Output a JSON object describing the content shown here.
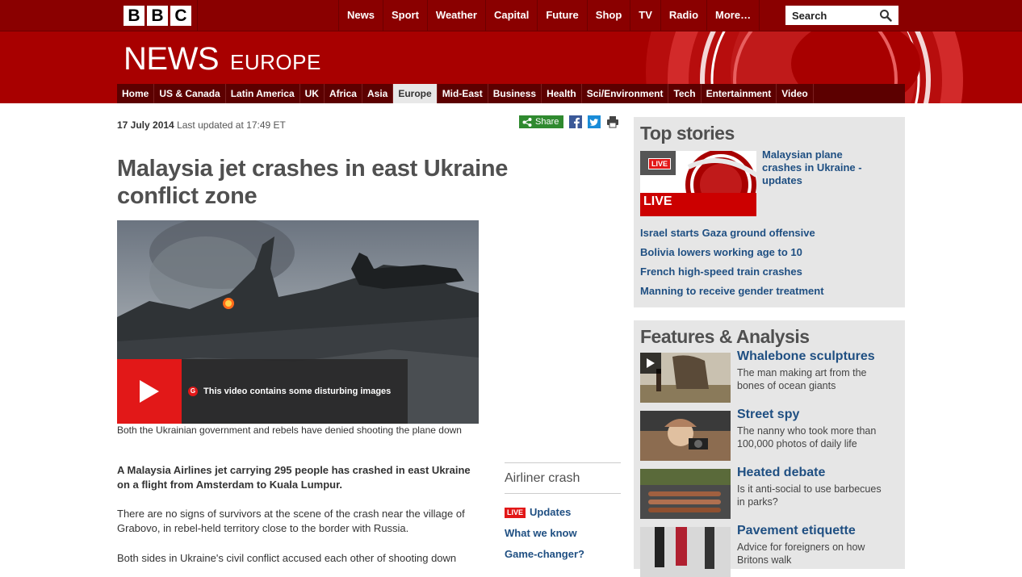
{
  "topbar": {
    "logo_letters": [
      "B",
      "B",
      "C"
    ],
    "nav": [
      "News",
      "Sport",
      "Weather",
      "Capital",
      "Future",
      "Shop",
      "TV",
      "Radio",
      "More…"
    ],
    "search_placeholder": "Search"
  },
  "masthead": {
    "news": "NEWS",
    "region": "EUROPE"
  },
  "section_nav": [
    "Home",
    "US & Canada",
    "Latin America",
    "UK",
    "Africa",
    "Asia",
    "Europe",
    "Mid-East",
    "Business",
    "Health",
    "Sci/Environment",
    "Tech",
    "Entertainment",
    "Video"
  ],
  "section_nav_active": "Europe",
  "article": {
    "date": "17 July 2014",
    "updated": "Last updated at 17:49 ET",
    "share_label": "Share",
    "headline": "Malaysia jet crashes in east Ukraine conflict zone",
    "video_badge": "G",
    "video_warning": "This video contains some disturbing images",
    "caption": "Both the Ukrainian government and rebels have denied shooting the plane down",
    "intro": "A Malaysia Airlines jet carrying 295 people has crashed in east Ukraine on a flight from Amsterdam to Kuala Lumpur.",
    "paragraphs": [
      "There are no signs of survivors at the scene of the crash near the village of Grabovo, in rebel-held territory close to the border with Russia.",
      "Both sides in Ukraine's civil conflict accused each other of shooting down"
    ]
  },
  "related": {
    "title": "Airliner crash",
    "live_tag": "LIVE",
    "links": [
      "Updates",
      "What we know",
      "Game-changer?"
    ]
  },
  "top_stories": {
    "title": "Top stories",
    "live_badge_small": "LIVE",
    "live_badge_large": "LIVE",
    "lead": "Malaysian plane crashes in Ukraine - updates",
    "items": [
      "Israel starts Gaza ground offensive",
      "Bolivia lowers working age to 10",
      "French high-speed train crashes",
      "Manning to receive gender treatment"
    ]
  },
  "features": {
    "title": "Features & Analysis",
    "items": [
      {
        "title": "Whalebone sculptures",
        "desc": "The man making art from the bones of ocean giants"
      },
      {
        "title": "Street spy",
        "desc": "The nanny who took more than 100,000 photos of daily life"
      },
      {
        "title": "Heated debate",
        "desc": "Is it anti-social to use barbecues in parks?"
      },
      {
        "title": "Pavement etiquette",
        "desc": "Advice for foreigners on how Britons walk"
      }
    ]
  },
  "colors": {
    "bbc_red": "#a80000",
    "top_bar": "#8a0000",
    "link_blue": "#1f4f82",
    "live_red": "#e21818",
    "share_green": "#2f8a2f"
  }
}
